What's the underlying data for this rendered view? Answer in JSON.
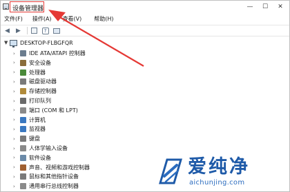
{
  "window": {
    "title": "设备管理器",
    "controls": {
      "minimize": "—",
      "maximize": "☐",
      "close": "✕"
    }
  },
  "menu": {
    "items": [
      {
        "label": "文件(F)"
      },
      {
        "label": "操作(A)"
      },
      {
        "label": "查看(V)"
      },
      {
        "label": "帮助(H)"
      }
    ]
  },
  "toolbar": {
    "back_icon": "arrow-left-icon",
    "forward_icon": "arrow-right-icon",
    "properties_icon": "properties-icon",
    "help_icon": "help-icon",
    "monitor_icon": "monitor-icon",
    "help_glyph": "?"
  },
  "tree": {
    "root": {
      "label": "DESKTOP-FLBGFQR"
    },
    "nodes": [
      {
        "label": "IDE ATA/ATAPI 控制器",
        "icon": "ide-controller-icon",
        "color": "#6b7c8e"
      },
      {
        "label": "安全设备",
        "icon": "security-device-icon",
        "color": "#8a6d3b"
      },
      {
        "label": "处理器",
        "icon": "processor-icon",
        "color": "#4a8a3a"
      },
      {
        "label": "磁盘驱动器",
        "icon": "disk-drive-icon",
        "color": "#7a7a7a"
      },
      {
        "label": "存储控制器",
        "icon": "storage-controller-icon",
        "color": "#b08a3a"
      },
      {
        "label": "打印队列",
        "icon": "printer-icon",
        "color": "#6a6a6a"
      },
      {
        "label": "端口 (COM 和 LPT)",
        "icon": "port-icon",
        "color": "#8a8a8a"
      },
      {
        "label": "计算机",
        "icon": "computer-icon",
        "color": "#3a78c0"
      },
      {
        "label": "监视器",
        "icon": "monitor-icon",
        "color": "#3a78c0"
      },
      {
        "label": "键盘",
        "icon": "keyboard-icon",
        "color": "#7a7a7a"
      },
      {
        "label": "人体学输入设备",
        "icon": "hid-icon",
        "color": "#8a8a8a"
      },
      {
        "label": "软件设备",
        "icon": "software-device-icon",
        "color": "#6b8aa8"
      },
      {
        "label": "声音、视频和游戏控制器",
        "icon": "sound-icon",
        "color": "#a06030"
      },
      {
        "label": "鼠标和其他指针设备",
        "icon": "mouse-icon",
        "color": "#7a7a7a"
      },
      {
        "label": "通用串行总线控制器",
        "icon": "usb-icon",
        "color": "#8a8a8a"
      }
    ]
  },
  "annotation": {
    "color": "#e53935"
  },
  "watermark": {
    "text": "爱纯净",
    "url": "aichunjing.com",
    "color": "#1e5aa8"
  }
}
